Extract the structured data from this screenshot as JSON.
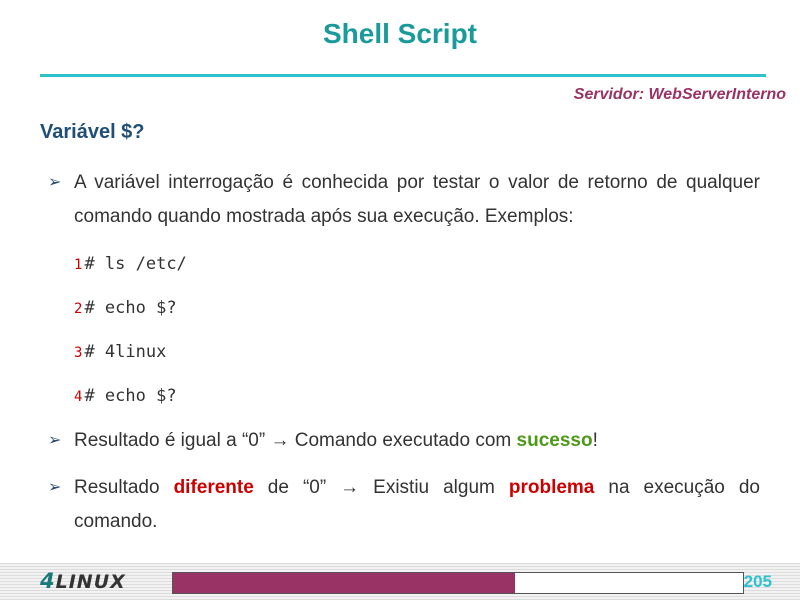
{
  "header": {
    "title": "Shell Script",
    "server": "Servidor: WebServerInterno"
  },
  "section": {
    "heading": "Variável $?"
  },
  "bullets": {
    "first": "A variável interrogação é conhecida por testar o valor de retorno de qualquer comando quando mostrada após sua execução. Exemplos:",
    "second": {
      "prefix": "Resultado é igual a “0” → Comando executado com ",
      "highlight": "sucesso",
      "suffix": "!"
    },
    "third": {
      "prefix": "Resultado ",
      "highlight1": "diferente",
      "middle": " de “0” → Existiu algum ",
      "highlight2": "problema",
      "suffix": " na execução do comando."
    }
  },
  "code": [
    {
      "num": "1",
      "text": "# ls /etc/"
    },
    {
      "num": "2",
      "text": "# echo $?"
    },
    {
      "num": "3",
      "text": "# 4linux"
    },
    {
      "num": "4",
      "text": "# echo $?"
    }
  ],
  "footer": {
    "logo_prefix": "4",
    "logo_suffix": "LINUX",
    "page_number": "205",
    "progress_fraction": 0.6
  },
  "colors": {
    "title": "#1a9a9a",
    "server": "#993366",
    "heading": "#1f4e79",
    "success": "#4d9a1a",
    "problem": "#cc0000",
    "progress": "#993366"
  }
}
